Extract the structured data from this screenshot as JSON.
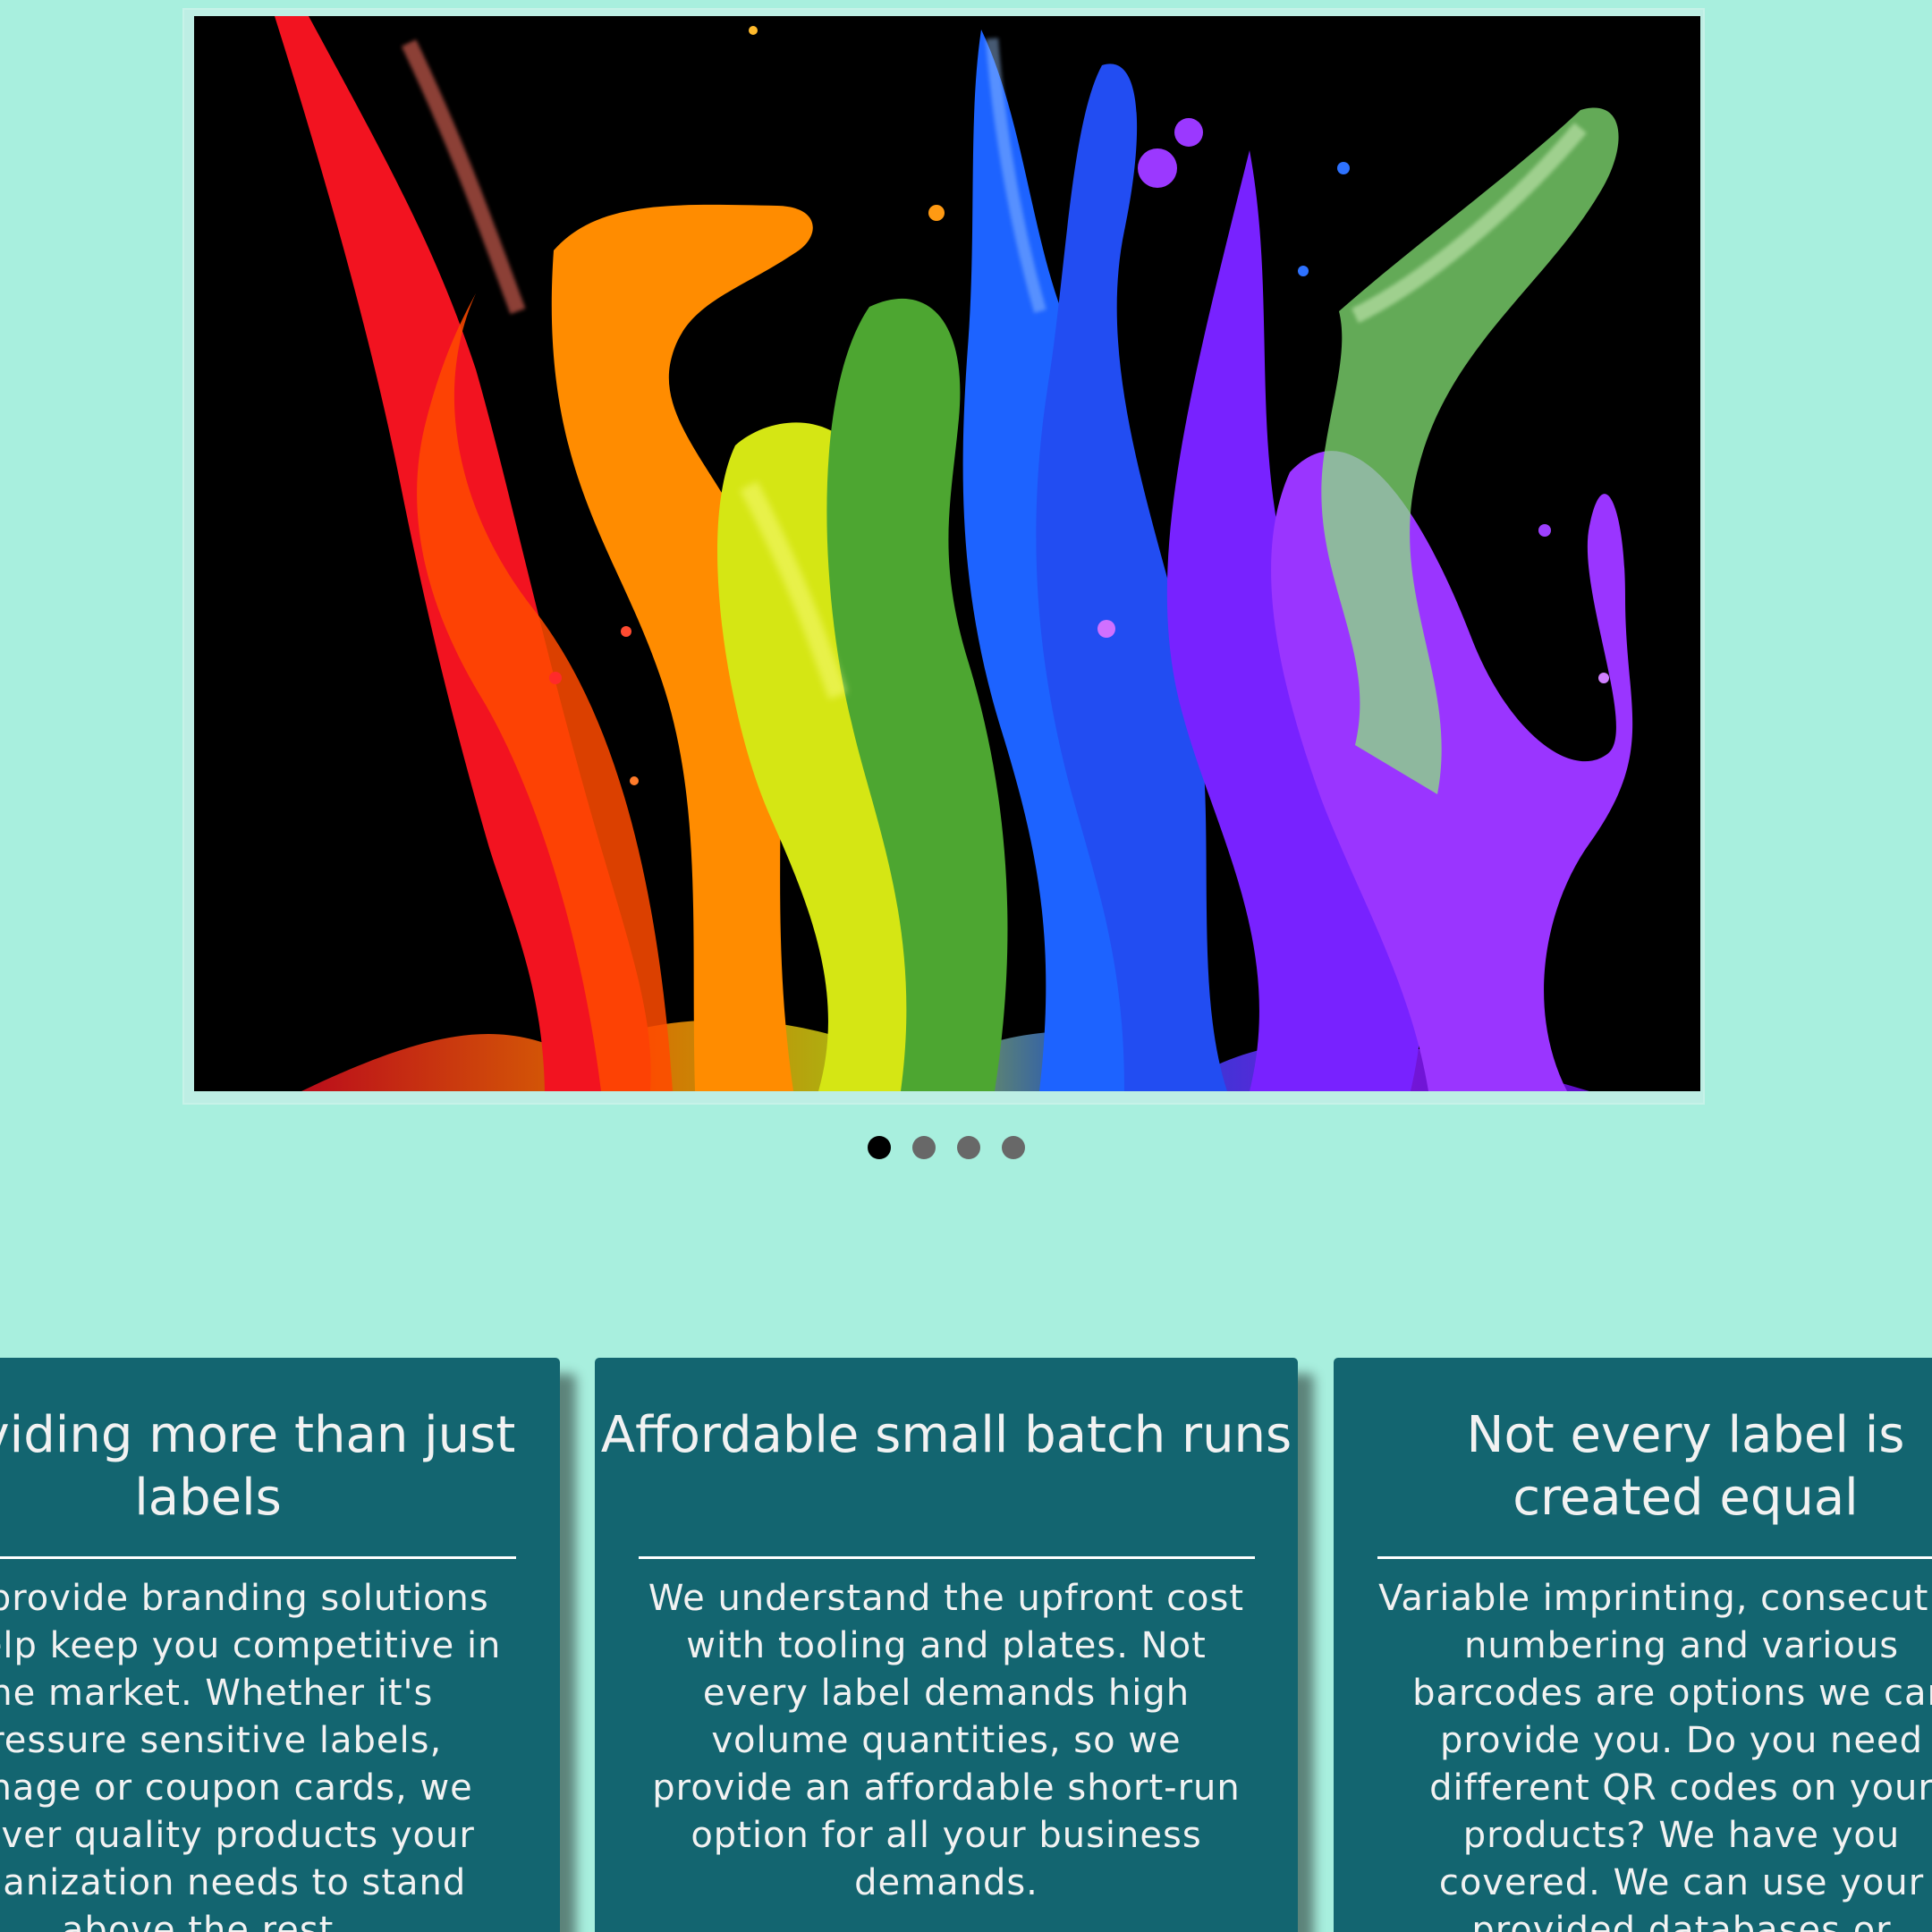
{
  "carousel": {
    "slide_count": 4,
    "active_slide": 1
  },
  "cards": [
    {
      "title": "Providing more than just labels",
      "body": "We provide branding solutions to help keep you competitive in the market. Whether it's pressure sensitive labels, signage or coupon cards, we deliver quality products your organization needs to stand above the rest."
    },
    {
      "title": "Affordable small batch runs",
      "body": "We understand the upfront cost with tooling and plates. Not every label demands high volume quantities, so we provide an affordable short-run option for all your business demands."
    },
    {
      "title": "Not every label is created equal",
      "body": "Variable imprinting, consecutive numbering and various barcodes are options we can provide you. Do you need different QR codes on your products? We have you covered. We can use your provided databases or"
    }
  ],
  "colors": {
    "page_background": "#a8efde",
    "card_background": "#136570",
    "active_dot": "#000000",
    "inactive_dot": "#686868"
  }
}
